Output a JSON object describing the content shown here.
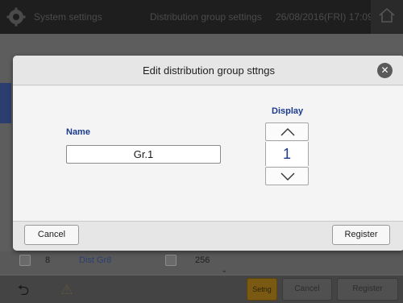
{
  "topbar": {
    "system_settings": "System settings",
    "distribution_group_settings": "Distribution group settings",
    "datetime": "26/08/2016(FRI) 17:09"
  },
  "background_row": {
    "number": "8",
    "name": "Dist Gr8",
    "value": "256"
  },
  "bottombar": {
    "setng": "Setng",
    "cancel": "Cancel",
    "register": "Register"
  },
  "dialog": {
    "title": "Edit distribution group sttngs",
    "name_label": "Name",
    "name_value": "Gr.1",
    "display_label": "Display",
    "display_value": "1",
    "cancel_label": "Cancel",
    "register_label": "Register"
  },
  "icons": {
    "gear": "gear-icon",
    "home": "home-icon",
    "close": "close-icon",
    "chevron_up": "chevron-up-icon",
    "chevron_down": "chevron-down-icon",
    "back": "back-icon",
    "warning": "warning-icon"
  },
  "colors": {
    "accent_blue": "#1b3a8c",
    "setng_orange": "#7a5a12"
  }
}
